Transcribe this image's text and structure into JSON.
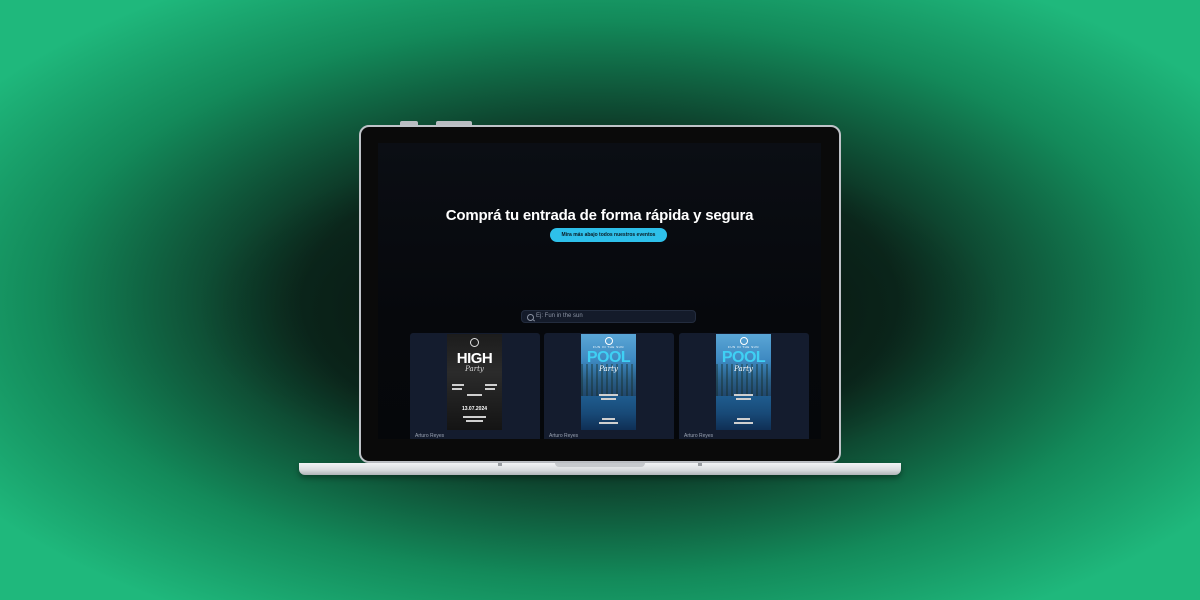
{
  "hero": {
    "headline": "Comprá tu entrada de forma rápida y segura",
    "cta_label": "Mira más abajo todos nuestros eventos"
  },
  "search": {
    "placeholder": "Ej: Fun in the sun"
  },
  "events": [
    {
      "poster_title": "HIGH",
      "poster_subtitle": "Party",
      "poster_date": "13.07.2024",
      "author": "Arturo Reyes"
    },
    {
      "poster_top": "FUN IN THE SUN",
      "poster_title": "POOL",
      "poster_subtitle": "Party",
      "author": "Arturo Reyes"
    },
    {
      "poster_top": "FUN IN THE SUN",
      "poster_title": "POOL",
      "poster_subtitle": "Party",
      "author": "Arturo Reyes"
    }
  ],
  "colors": {
    "accent": "#2ec0ea",
    "screen_bg": "#06080c",
    "card_bg": "#141c2e",
    "background_green": "#1fb87c"
  }
}
